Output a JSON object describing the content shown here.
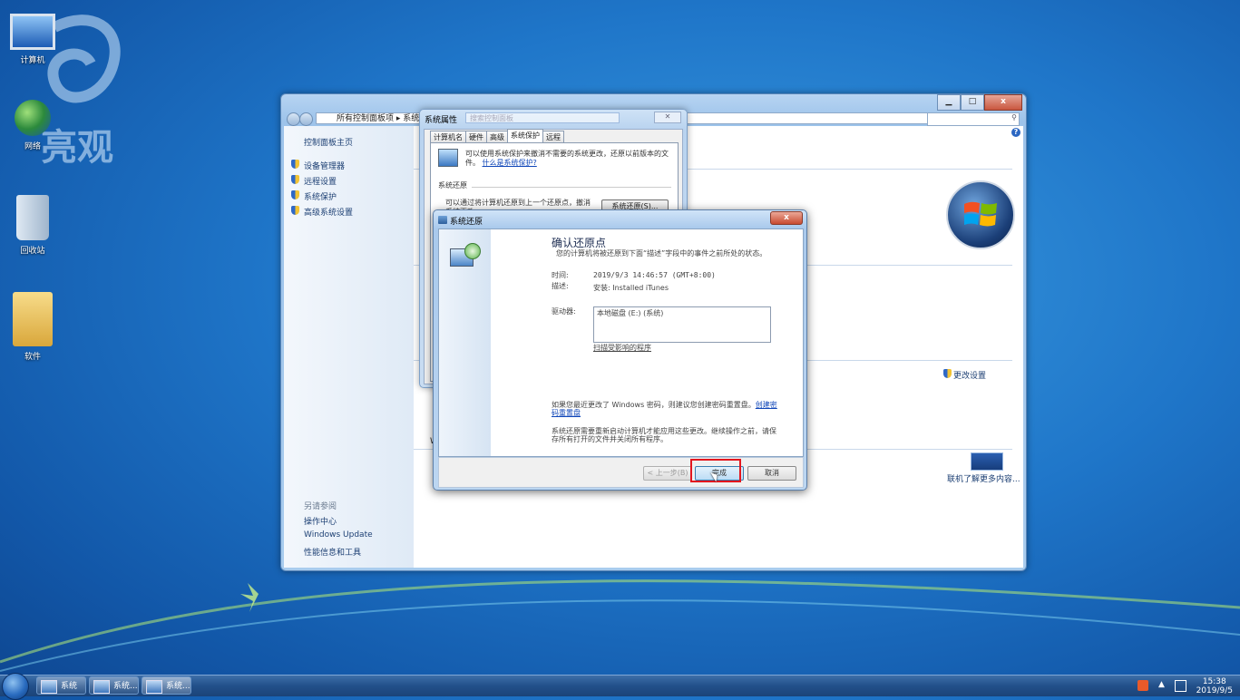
{
  "desktop": {
    "icons": [
      {
        "label": "计算机"
      },
      {
        "label": "网络"
      },
      {
        "label": "回收站"
      },
      {
        "label": "软件"
      }
    ],
    "watermark_text": "亮观"
  },
  "control_panel": {
    "breadcrumb": "所有控制面板项 ▸ 系统",
    "title_buttons": {
      "minimize": "▁",
      "maximize": "□",
      "close": "x"
    },
    "sidebar": {
      "home": "控制面板主页",
      "links": [
        "设备管理器",
        "远程设置",
        "系统保护",
        "高级系统设置"
      ],
      "see_also_heading": "另请参阅",
      "see_also": [
        "操作中心",
        "Windows Update",
        "性能信息和工具"
      ]
    },
    "change_settings": "更改设置",
    "license_link": "联机了解更多内容...",
    "partial_text": "Wi",
    "help_icon": "?"
  },
  "system_properties": {
    "title": "系统属性",
    "search_placeholder": "搜索控制面板",
    "tabs": [
      "计算机名",
      "硬件",
      "高级",
      "系统保护",
      "远程"
    ],
    "active_tab": "系统保护",
    "intro_text": "可以使用系统保护来撤消不需要的系统更改，还原以前版本的文件。",
    "intro_link": "什么是系统保护?",
    "section_title": "系统还原",
    "restore_text": "可以通过将计算机还原到上一个还原点，撤消系统更改。",
    "restore_button": "系统还原(S)..."
  },
  "system_restore": {
    "title": "系统还原",
    "heading": "确认还原点",
    "description": "您的计算机将被还原到下面“描述”字段中的事件之前所处的状态。",
    "time_label": "时间:",
    "time_value": "2019/9/3 14:46:57 (GMT+8:00)",
    "desc_label": "描述:",
    "desc_value": "安装: Installed iTunes",
    "drives_label": "驱动器:",
    "drives_value": "本地磁盘 (E:) (系统)",
    "affected_link": "扫描受影响的程序",
    "password_note": "如果您最近更改了 Windows 密码，则建议您创建密码重置盘。",
    "password_link": "创建密码重置盘",
    "restart_note": "系统还原需要重新启动计算机才能应用这些更改。继续操作之前，请保存所有打开的文件并关闭所有程序。",
    "buttons": {
      "back": "< 上一步(B)",
      "finish": "完成",
      "cancel": "取消"
    },
    "close": "x"
  },
  "taskbar": {
    "items": [
      "系统",
      "系统...",
      "系统..."
    ],
    "time": "15:38",
    "date": "2019/9/5"
  },
  "colors": {
    "highlight": "#e3161e",
    "link": "#0f46b8"
  }
}
